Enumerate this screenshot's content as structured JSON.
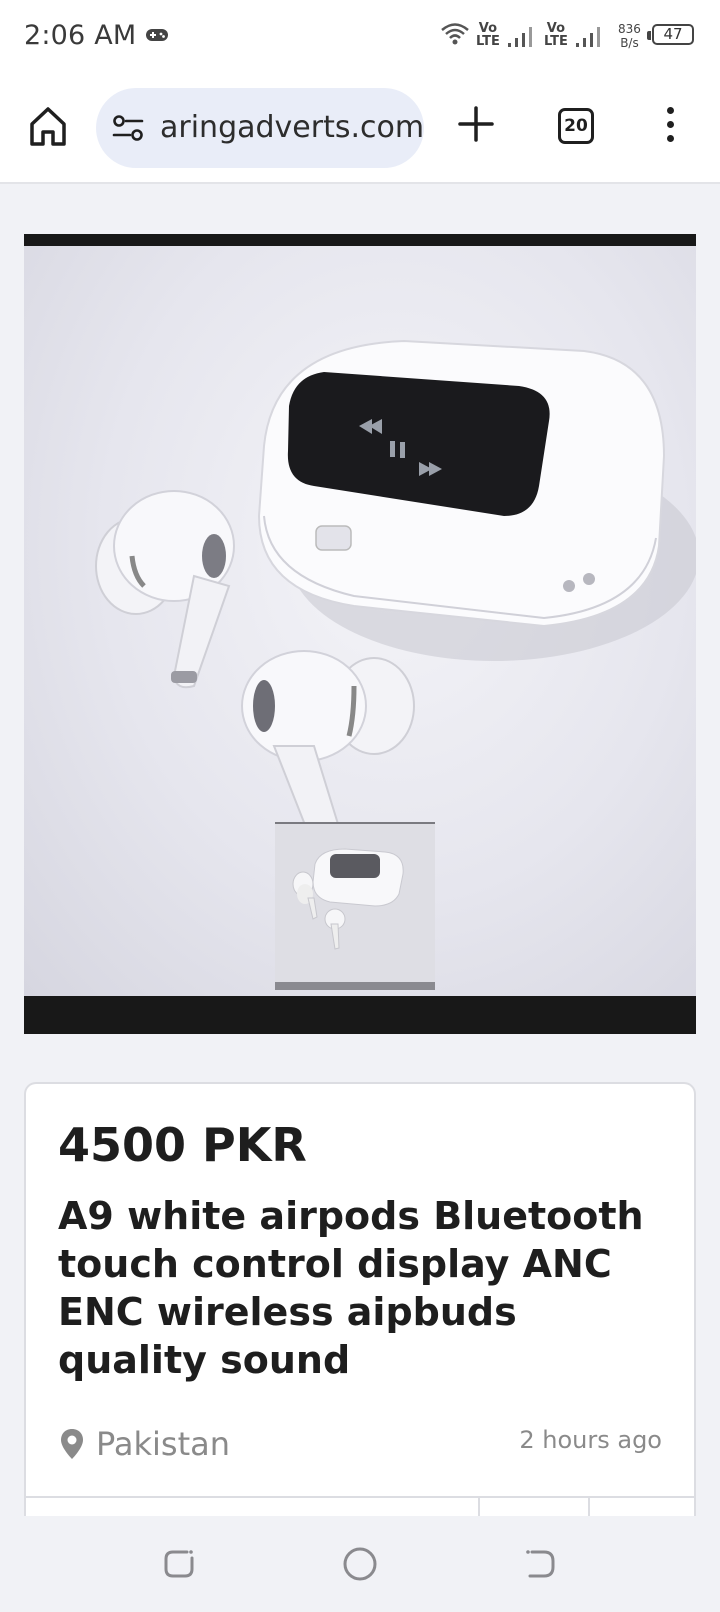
{
  "status_bar": {
    "time": "2:06 AM",
    "net1_vo": "Vo",
    "net1_lte": "LTE",
    "net2_vo": "Vo",
    "net2_lte": "LTE",
    "speed_value": "836",
    "speed_unit": "B/s",
    "battery": "47",
    "icons": [
      "gamepad-icon",
      "wifi-icon",
      "signal-icon",
      "signal-icon",
      "battery-icon"
    ]
  },
  "browser": {
    "url": "aringadverts.com",
    "tab_count": "20",
    "icons": [
      "home-icon",
      "site-info-icon",
      "plus-icon",
      "tabs-icon",
      "more-vert-icon"
    ]
  },
  "listing": {
    "price": "4500 PKR",
    "title": "A9 white airpods Bluetooth touch control display ANC ENC wireless aipbuds quality sound",
    "location": "Pakistan",
    "posted": "2 hours ago"
  },
  "nav_bar": {
    "icons": [
      "recents-icon",
      "home-circle-icon",
      "back-icon"
    ]
  }
}
